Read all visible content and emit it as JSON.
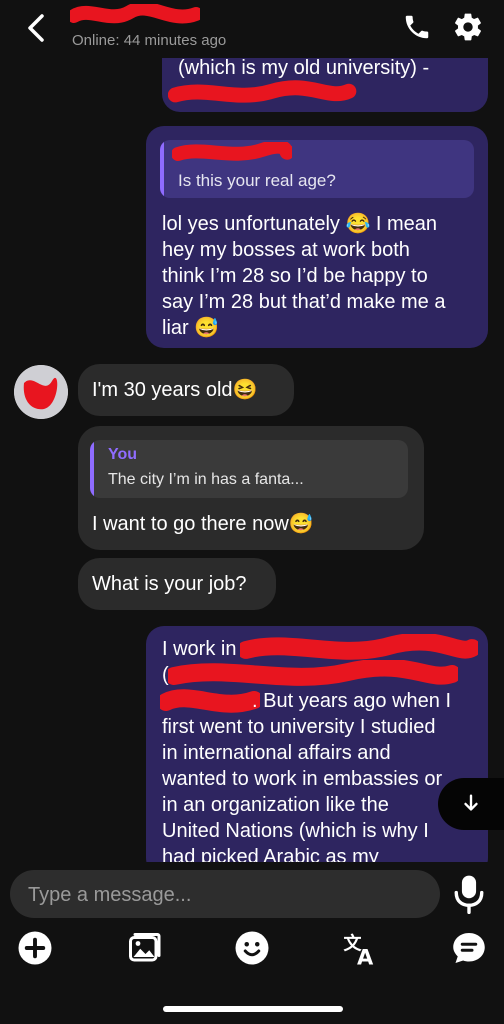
{
  "header": {
    "status": "Online: 44 minutes ago"
  },
  "messages": {
    "m1_text": "(which is my old university) -",
    "m2_quote_text": "Is this your real age?",
    "m2_lines": [
      "lol yes unfortunately 😂 I mean",
      "hey my bosses at work both",
      "think I’m 28 so I’d be happy to",
      "say I’m 28 but that’d make me a",
      "liar 😅"
    ],
    "m3_text": "I'm 30 years old😆",
    "m4_quote_author": "You",
    "m4_quote_text": "The city I’m in has a fanta...",
    "m4_text": "I want to go there now😅",
    "m5_text": "What is your job?",
    "m6_line1": "I work in",
    "m6_line2": "(",
    "m6_line3": ". But years ago when I",
    "m6_lines_rest": [
      "first went to university I studied",
      "in international affairs and",
      "wanted to work in embassies or",
      "in an organization like the",
      "United Nations (which is why I",
      "had picked Arabic as my"
    ]
  },
  "composer": {
    "placeholder": "Type a message..."
  },
  "icons": [
    "back-icon",
    "phone-icon",
    "gear-icon",
    "arrow-down-icon",
    "mic-icon",
    "plus-icon",
    "image-icon",
    "emoji-icon",
    "translate-icon",
    "quick-reply-icon"
  ],
  "colors": {
    "background": "#111111",
    "outgoing_bubble": "#2e2560",
    "incoming_bubble": "#2b2b2b",
    "quote_accent": "#8f6cff",
    "redaction": "#e8151f"
  }
}
